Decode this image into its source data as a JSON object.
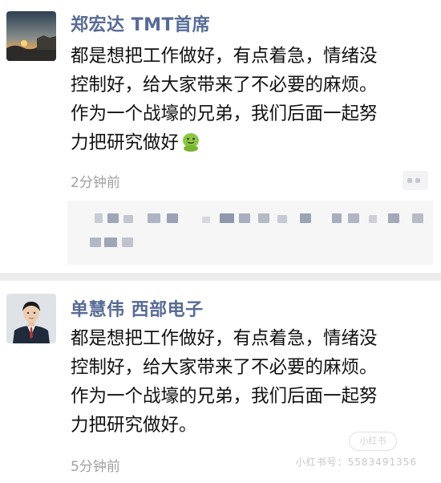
{
  "posts": [
    {
      "author": "郑宏达 TMT首席",
      "text_lines": [
        "都是想把工作做好，有点着急，情绪没",
        "控制好，给大家带来了不必要的麻烦。",
        "作为一个战壕的兄弟，我们后面一起努",
        "力把研究做好"
      ],
      "emoji": "sweat-smile-icon",
      "time": "2分钟前"
    },
    {
      "author": "单慧伟  西部电子",
      "text_lines": [
        "都是想把工作做好，有点着急，情绪没",
        "控制好，给大家带来了不必要的麻烦。",
        "作为一个战壕的兄弟，我们后面一起努",
        "力把研究做好。"
      ],
      "time": "5分钟前"
    }
  ],
  "watermark": {
    "logo": "小红书",
    "text": "小红书号：5583491356"
  },
  "colors": {
    "name": "#576b95",
    "text": "#111111",
    "time": "#a0a0a0",
    "divider": "#ededed"
  }
}
